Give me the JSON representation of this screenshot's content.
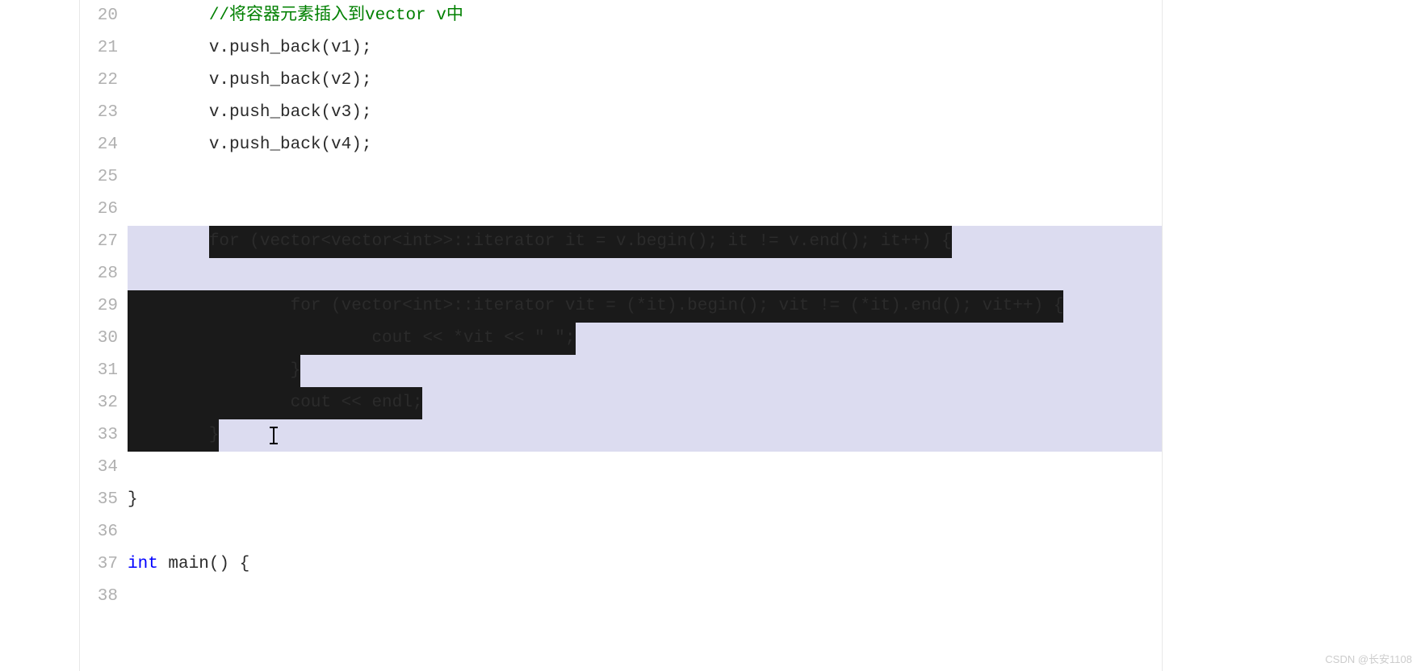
{
  "editor": {
    "lines": [
      {
        "number": "20",
        "segments": [
          {
            "kind": "indent",
            "text": "        "
          },
          {
            "kind": "comment",
            "text": "//将容器元素插入到vector v中"
          }
        ]
      },
      {
        "number": "21",
        "segments": [
          {
            "kind": "indent",
            "text": "        "
          },
          {
            "kind": "code",
            "text": "v.push_back(v1);"
          }
        ]
      },
      {
        "number": "22",
        "segments": [
          {
            "kind": "indent",
            "text": "        "
          },
          {
            "kind": "code",
            "text": "v.push_back(v2);"
          }
        ]
      },
      {
        "number": "23",
        "segments": [
          {
            "kind": "indent",
            "text": "        "
          },
          {
            "kind": "code",
            "text": "v.push_back(v3);"
          }
        ]
      },
      {
        "number": "24",
        "segments": [
          {
            "kind": "indent",
            "text": "        "
          },
          {
            "kind": "code",
            "text": "v.push_back(v4);"
          }
        ]
      },
      {
        "number": "25",
        "segments": []
      },
      {
        "number": "26",
        "segments": []
      },
      {
        "number": "27",
        "selectionBg": true,
        "segments": [
          {
            "kind": "indent",
            "text": "        ",
            "selected": false
          },
          {
            "kind": "code",
            "text": "for (vector<vector<int>>::iterator it = v.begin(); it != v.end(); it++) {",
            "selected": true
          }
        ]
      },
      {
        "number": "28",
        "selectionBg": true,
        "segments": []
      },
      {
        "number": "29",
        "selectionBg": true,
        "segments": [
          {
            "kind": "indent",
            "text": "",
            "selected": false
          },
          {
            "kind": "code",
            "text": "                for (vector<int>::iterator vit = (*it).begin(); vit != (*it).end(); vit++) {",
            "selected": true
          }
        ]
      },
      {
        "number": "30",
        "selectionBg": true,
        "segments": [
          {
            "kind": "indent",
            "text": "",
            "selected": false
          },
          {
            "kind": "code",
            "text": "                        cout << *vit << \" \";",
            "selected": true
          }
        ]
      },
      {
        "number": "31",
        "selectionBg": true,
        "segments": [
          {
            "kind": "indent",
            "text": "",
            "selected": false
          },
          {
            "kind": "code",
            "text": "                }",
            "selected": true
          }
        ]
      },
      {
        "number": "32",
        "selectionBg": true,
        "segments": [
          {
            "kind": "indent",
            "text": "",
            "selected": false
          },
          {
            "kind": "code",
            "text": "                cout << endl;",
            "selected": true
          }
        ]
      },
      {
        "number": "33",
        "selectionBg": true,
        "hasCursor": true,
        "segments": [
          {
            "kind": "indent",
            "text": "",
            "selected": false
          },
          {
            "kind": "code",
            "text": "        }",
            "selected": true
          }
        ]
      },
      {
        "number": "34",
        "segments": []
      },
      {
        "number": "35",
        "segments": [
          {
            "kind": "code",
            "text": "}"
          }
        ]
      },
      {
        "number": "36",
        "segments": []
      },
      {
        "number": "37",
        "segments": [
          {
            "kind": "keyword",
            "text": "int "
          },
          {
            "kind": "code",
            "text": "main() {"
          }
        ]
      },
      {
        "number": "38",
        "segments": []
      }
    ]
  },
  "watermark": "CSDN @长安1108"
}
